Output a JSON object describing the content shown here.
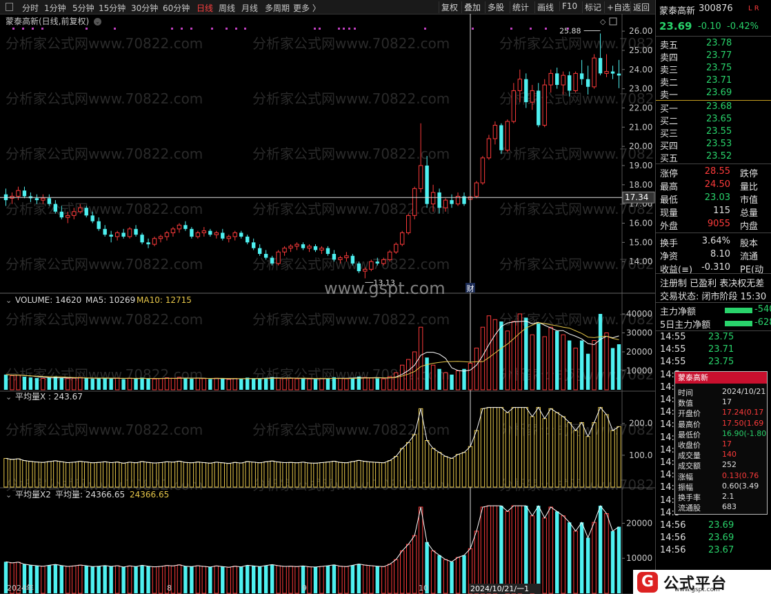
{
  "toolbar": {
    "periods": [
      "分时",
      "1分钟",
      "5分钟",
      "15分钟",
      "30分钟",
      "60分钟",
      "日线",
      "周线",
      "月线",
      "多周期",
      "更多 〉"
    ],
    "active_period": "日线",
    "right_buttons": [
      "复权",
      "叠加",
      "多股",
      "统计",
      "画线",
      "F10",
      "标记",
      "+自选",
      "返回"
    ]
  },
  "stock": {
    "name": "蒙泰高新",
    "code": "300876",
    "tags": "L R",
    "price": "23.69",
    "change": "-0.10",
    "change_pct": "-0.42%",
    "chart_title": "蒙泰高新(日线,前复权)"
  },
  "orderbook": {
    "asks": [
      [
        "卖五",
        "23.78"
      ],
      [
        "卖四",
        "23.77"
      ],
      [
        "卖三",
        "23.75"
      ],
      [
        "卖二",
        "23.71"
      ],
      [
        "卖一",
        "23.69"
      ]
    ],
    "bids": [
      [
        "买一",
        "23.68"
      ],
      [
        "买二",
        "23.65"
      ],
      [
        "买三",
        "23.55"
      ],
      [
        "买四",
        "23.53"
      ],
      [
        "买五",
        "23.52"
      ]
    ]
  },
  "stats": [
    {
      "label": "涨停",
      "value": "28.55",
      "cls": "up",
      "label2": "跌停"
    },
    {
      "label": "最高",
      "value": "24.50",
      "cls": "up",
      "label2": "量比"
    },
    {
      "label": "最低",
      "value": "23.03",
      "cls": "dn",
      "label2": "市值"
    },
    {
      "label": "现量",
      "value": "115",
      "cls": "wh",
      "label2": "总量"
    },
    {
      "label": "外盘",
      "value": "9055",
      "cls": "up",
      "label2": "内盘"
    },
    {
      "label": "换手",
      "value": "3.64%",
      "cls": "wh",
      "label2": "股本"
    },
    {
      "label": "净资",
      "value": "8.10",
      "cls": "wh",
      "label2": "流通"
    },
    {
      "label": "收益(≡)",
      "value": "-0.310",
      "cls": "wh",
      "label2": "PE(动"
    }
  ],
  "flags": "注册制 已盈利 表决权无差",
  "trade_status": "交易状态: 闭市阶段 15:30",
  "main_flow": [
    {
      "label": "主力净额",
      "value": "-540"
    },
    {
      "label": "5日主力净额",
      "value": "-628"
    }
  ],
  "ticks": [
    [
      "14:55",
      "23.75",
      "dn"
    ],
    [
      "14:55",
      "23.71",
      "dn"
    ],
    [
      "14:55",
      "23.75",
      "dn"
    ],
    [
      "14:5",
      "",
      ""
    ],
    [
      "14:5",
      "",
      ""
    ],
    [
      "14:5",
      "",
      ""
    ],
    [
      "14:5",
      "",
      ""
    ],
    [
      "14:5",
      "",
      ""
    ],
    [
      "14:5",
      "",
      ""
    ],
    [
      "14:5",
      "",
      ""
    ],
    [
      "14:5",
      "",
      ""
    ],
    [
      "14:5",
      "",
      ""
    ],
    [
      "14:5",
      "",
      ""
    ],
    [
      "14:5",
      "",
      ""
    ],
    [
      "14:5",
      "",
      ""
    ],
    [
      "14:56",
      "23.69",
      "dn"
    ],
    [
      "14:56",
      "23.69",
      "dn"
    ],
    [
      "14:56",
      "23.67",
      "dn"
    ]
  ],
  "tooltip": {
    "title": "蒙泰高新",
    "rows": [
      [
        "时间",
        "2024/10/21",
        "wh"
      ],
      [
        "数值",
        "17",
        "wh"
      ],
      [
        "开盘价",
        "17.24(0.17",
        "up"
      ],
      [
        "最高价",
        "17.50(1.69",
        "up"
      ],
      [
        "最低价",
        "16.90(-1.80",
        "dn"
      ],
      [
        "收盘价",
        "17",
        "up"
      ],
      [
        "成交量",
        "140",
        "up"
      ],
      [
        "成交额",
        "252",
        "wh"
      ],
      [
        "涨幅",
        "0.13(0.76",
        "up"
      ],
      [
        "振幅",
        "0.60(3.49",
        "wh"
      ],
      [
        "换手率",
        "2.1",
        "wh"
      ],
      [
        "流通股",
        "683",
        "wh"
      ]
    ]
  },
  "panels": {
    "volume_label": "VOLUME: 14620",
    "ma5_label": "MA5: 10269",
    "ma10_label": "MA10: 12715",
    "avgx_label": "平均量X : 243.67",
    "avgx2_label": "平均量X2",
    "avgvol_label": "平均量: 24366.65",
    "avgvol_value": "24366.65"
  },
  "axes": {
    "price_ticks": [
      "26.00",
      "25.00",
      "24.00",
      "23.00",
      "22.00",
      "21.00",
      "20.00",
      "19.00",
      "18.00",
      "17.00",
      "16.00",
      "15.00",
      "14.00"
    ],
    "crosshair_price": "17.34",
    "volume_ticks": [
      "40000",
      "30000",
      "20000",
      "10000"
    ],
    "avgx_ticks": [
      "200.0",
      "100.0"
    ],
    "avgx2_ticks": [
      "20000",
      "10000"
    ],
    "x_labels": [
      "2024年",
      "8",
      "9",
      "10",
      "2024/10/21/一1"
    ],
    "high_marker": "25.88",
    "low_marker": "13.13",
    "cai_marker": "财"
  },
  "colors": {
    "up": "#ff3b3b",
    "down": "#4ef0f0",
    "ma5": "#ffffff",
    "ma10": "#e8c84a",
    "avg": "#e8c84a"
  },
  "chart_data": {
    "type": "candlestick",
    "ohlc": [
      [
        17.5,
        17.8,
        16.9,
        17.2
      ],
      [
        17.3,
        17.6,
        17.0,
        17.4
      ],
      [
        17.4,
        17.9,
        17.2,
        17.7
      ],
      [
        17.7,
        17.9,
        17.3,
        17.4
      ],
      [
        17.4,
        17.6,
        17.1,
        17.3
      ],
      [
        17.3,
        17.5,
        17.0,
        17.2
      ],
      [
        17.2,
        17.5,
        17.0,
        17.3
      ],
      [
        17.3,
        17.5,
        16.9,
        17.0
      ],
      [
        17.0,
        17.2,
        16.5,
        16.6
      ],
      [
        16.6,
        16.9,
        16.2,
        16.3
      ],
      [
        16.3,
        16.6,
        16.0,
        16.4
      ],
      [
        16.4,
        16.8,
        16.2,
        16.6
      ],
      [
        16.6,
        17.0,
        16.5,
        16.8
      ],
      [
        16.8,
        16.9,
        16.3,
        16.4
      ],
      [
        16.4,
        16.6,
        16.0,
        16.1
      ],
      [
        16.1,
        16.3,
        15.6,
        15.7
      ],
      [
        15.7,
        15.9,
        15.3,
        15.4
      ],
      [
        15.4,
        15.6,
        15.0,
        15.3
      ],
      [
        15.3,
        15.6,
        15.1,
        15.5
      ],
      [
        15.5,
        15.7,
        15.2,
        15.3
      ],
      [
        15.3,
        15.8,
        15.2,
        15.7
      ],
      [
        15.7,
        15.9,
        15.3,
        15.4
      ],
      [
        15.4,
        15.5,
        14.9,
        15.0
      ],
      [
        15.0,
        15.2,
        14.7,
        14.9
      ],
      [
        14.9,
        15.3,
        14.8,
        15.2
      ],
      [
        15.2,
        15.4,
        15.0,
        15.3
      ],
      [
        15.3,
        15.6,
        15.1,
        15.5
      ],
      [
        15.5,
        15.8,
        15.3,
        15.7
      ],
      [
        15.7,
        16.0,
        15.5,
        15.9
      ],
      [
        15.9,
        16.1,
        15.6,
        15.7
      ],
      [
        15.7,
        15.8,
        15.2,
        15.3
      ],
      [
        15.3,
        15.6,
        15.2,
        15.5
      ],
      [
        15.5,
        15.8,
        15.3,
        15.6
      ],
      [
        15.6,
        15.7,
        15.3,
        15.4
      ],
      [
        15.4,
        15.6,
        15.2,
        15.5
      ],
      [
        15.5,
        15.7,
        15.1,
        15.2
      ],
      [
        15.2,
        15.4,
        15.0,
        15.3
      ],
      [
        15.3,
        15.6,
        15.1,
        15.5
      ],
      [
        15.5,
        15.6,
        15.2,
        15.3
      ],
      [
        15.3,
        15.4,
        14.9,
        15.0
      ],
      [
        15.0,
        15.2,
        14.6,
        14.7
      ],
      [
        14.7,
        14.9,
        14.3,
        14.4
      ],
      [
        14.4,
        14.6,
        14.1,
        14.2
      ],
      [
        14.2,
        14.3,
        13.8,
        13.9
      ],
      [
        13.9,
        14.6,
        13.8,
        14.5
      ],
      [
        14.5,
        14.8,
        14.3,
        14.7
      ],
      [
        14.7,
        14.9,
        14.5,
        14.8
      ],
      [
        14.8,
        15.0,
        14.6,
        14.9
      ],
      [
        14.9,
        15.0,
        14.6,
        14.7
      ],
      [
        14.7,
        14.9,
        14.5,
        14.8
      ],
      [
        14.8,
        14.9,
        14.5,
        14.6
      ],
      [
        14.6,
        14.8,
        14.4,
        14.7
      ],
      [
        14.7,
        14.8,
        14.3,
        14.4
      ],
      [
        14.4,
        14.6,
        14.0,
        14.1
      ],
      [
        14.1,
        14.3,
        13.9,
        14.2
      ],
      [
        14.2,
        14.5,
        14.0,
        14.3
      ],
      [
        14.3,
        14.4,
        13.8,
        13.9
      ],
      [
        13.9,
        14.0,
        13.4,
        13.5
      ],
      [
        13.5,
        13.7,
        13.13,
        13.6
      ],
      [
        13.6,
        14.1,
        13.5,
        14.0
      ],
      [
        14.0,
        14.2,
        13.8,
        13.9
      ],
      [
        13.9,
        14.2,
        13.8,
        14.1
      ],
      [
        14.1,
        14.6,
        14.0,
        14.5
      ],
      [
        14.5,
        15.0,
        14.4,
        14.9
      ],
      [
        14.9,
        15.6,
        14.8,
        15.5
      ],
      [
        15.5,
        16.5,
        15.4,
        16.4
      ],
      [
        16.4,
        17.9,
        16.2,
        17.8
      ],
      [
        17.8,
        21.2,
        17.6,
        19.0
      ],
      [
        19.0,
        19.5,
        16.8,
        17.0
      ],
      [
        17.0,
        18.0,
        16.6,
        17.6
      ],
      [
        17.6,
        17.8,
        16.5,
        16.8
      ],
      [
        16.8,
        17.3,
        16.6,
        17.2
      ],
      [
        17.2,
        17.5,
        16.8,
        17.0
      ],
      [
        17.0,
        17.6,
        16.9,
        17.4
      ],
      [
        17.4,
        17.6,
        16.9,
        17.0
      ],
      [
        17.24,
        17.5,
        16.9,
        17.37
      ],
      [
        17.4,
        18.2,
        17.3,
        18.1
      ],
      [
        18.1,
        19.5,
        18.0,
        19.4
      ],
      [
        19.4,
        20.6,
        19.3,
        20.4
      ],
      [
        20.4,
        21.3,
        20.1,
        21.1
      ],
      [
        21.1,
        21.2,
        19.6,
        19.8
      ],
      [
        19.8,
        21.4,
        19.7,
        21.3
      ],
      [
        21.3,
        23.3,
        21.2,
        22.9
      ],
      [
        22.9,
        24.0,
        22.3,
        23.5
      ],
      [
        23.5,
        23.8,
        22.0,
        22.3
      ],
      [
        22.3,
        23.2,
        21.9,
        22.9
      ],
      [
        22.9,
        23.3,
        21.0,
        21.1
      ],
      [
        21.1,
        23.5,
        21.0,
        23.2
      ],
      [
        23.2,
        24.0,
        22.8,
        23.8
      ],
      [
        23.8,
        24.1,
        23.0,
        23.2
      ],
      [
        23.2,
        23.9,
        22.7,
        23.7
      ],
      [
        23.7,
        23.9,
        22.6,
        22.9
      ],
      [
        22.9,
        23.9,
        22.8,
        23.8
      ],
      [
        23.8,
        24.5,
        23.2,
        23.5
      ],
      [
        23.5,
        24.2,
        22.7,
        23.1
      ],
      [
        23.1,
        24.8,
        23.0,
        24.6
      ],
      [
        24.6,
        25.88,
        23.7,
        23.8
      ],
      [
        23.8,
        24.8,
        23.6,
        23.9
      ],
      [
        23.9,
        24.2,
        23.5,
        23.79
      ],
      [
        23.79,
        24.5,
        23.03,
        23.69
      ]
    ],
    "volume": [
      8000,
      7500,
      7800,
      6900,
      6500,
      6200,
      6000,
      6400,
      6800,
      6300,
      5900,
      6100,
      6500,
      6200,
      5800,
      6000,
      6300,
      5900,
      6200,
      5600,
      6100,
      5800,
      6400,
      6000,
      5700,
      5900,
      6300,
      6100,
      6600,
      6000,
      5800,
      6200,
      5900,
      5600,
      6100,
      5800,
      5500,
      6000,
      5700,
      6400,
      6100,
      5800,
      6300,
      6700,
      6200,
      5900,
      6000,
      5800,
      6100,
      5700,
      5600,
      5900,
      6200,
      6600,
      6000,
      5800,
      6400,
      7000,
      6500,
      6200,
      6000,
      5800,
      6900,
      9000,
      13000,
      16000,
      20000,
      33000,
      17000,
      13000,
      11000,
      9000,
      8000,
      10000,
      11000,
      14000,
      22000,
      33000,
      39000,
      37000,
      36000,
      31000,
      36000,
      40000,
      38000,
      29000,
      35000,
      28000,
      33000,
      31000,
      29000,
      26000,
      22000,
      26000,
      19000,
      26000,
      40000,
      30000,
      22000,
      24000
    ],
    "price_range": [
      13.0,
      26.4
    ],
    "volume_range": [
      0,
      44000
    ],
    "avgx_range": [
      0,
      260
    ],
    "avgx2_range": [
      0,
      26000
    ]
  }
}
